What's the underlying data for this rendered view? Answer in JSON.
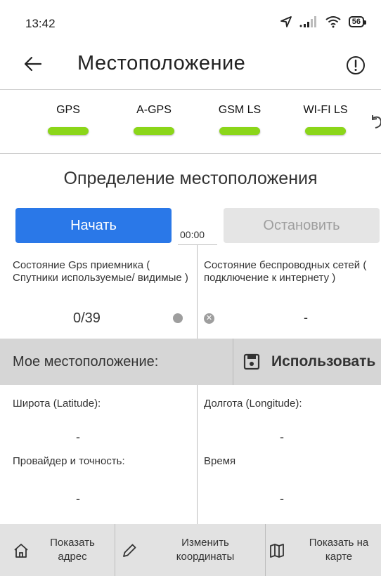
{
  "statusbar": {
    "time": "13:42",
    "battery": "56",
    "icons": [
      "location-arrow-icon",
      "signal-icon",
      "wifi-icon",
      "battery-icon"
    ]
  },
  "appbar": {
    "title": "Местоположение",
    "back_icon": "arrow-left-icon",
    "info_icon": "info-circle-icon"
  },
  "tabs": [
    {
      "label": "GPS",
      "status_color": "#8bd619"
    },
    {
      "label": "A-GPS",
      "status_color": "#8bd619"
    },
    {
      "label": "GSM LS",
      "status_color": "#8bd619"
    },
    {
      "label": "WI-FI LS",
      "status_color": "#8bd619"
    }
  ],
  "section": {
    "title": "Определение местоположения",
    "start_label": "Начать",
    "stop_label": "Остановить",
    "timer": "00:00"
  },
  "gps_status": {
    "label": "Состояние Gps приемника ( Спутники используемые/ видимые )",
    "value": "0/39"
  },
  "net_status": {
    "label": "Состояние беспроводных сетей ( подключение к интернету )",
    "value": "-"
  },
  "my_location": {
    "label": "Мое местоположение:",
    "use_label": "Использовать",
    "use_icon": "save-icon"
  },
  "fields": {
    "latitude_label": "Широта (Latitude):",
    "latitude_value": "-",
    "longitude_label": "Долгота (Longitude):",
    "longitude_value": "-",
    "provider_label": "Провайдер и точность:",
    "provider_value": "-",
    "time_label": "Время",
    "time_value": "-"
  },
  "bottom": {
    "show_address": "Показать адрес",
    "edit_coords": "Изменить координаты",
    "show_map": "Показать на карте"
  },
  "colors": {
    "accent": "#2a78e8",
    "status_ok": "#8bd619",
    "disabled_bg": "#e5e5e5"
  }
}
